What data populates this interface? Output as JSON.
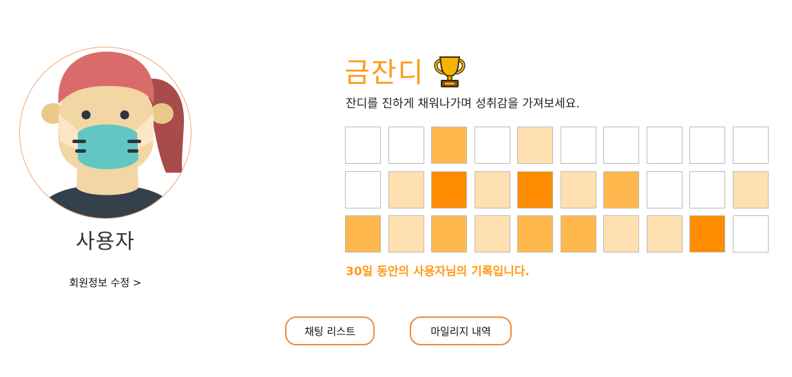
{
  "profile": {
    "name": "사용자",
    "edit_link": "회원정보 수정 >",
    "avatar_icon": "masked-user-avatar"
  },
  "grass": {
    "title": "금잔디",
    "trophy_icon": "trophy-icon",
    "subtitle": "잔디를 진하게 채워나가며 성취감을 가져보세요.",
    "record_text": "30일 동안의 사용자님의 기록입니다.",
    "levels": [
      0,
      0,
      2,
      0,
      1,
      0,
      0,
      0,
      0,
      0,
      0,
      1,
      3,
      1,
      3,
      1,
      2,
      0,
      0,
      1,
      2,
      1,
      2,
      1,
      2,
      2,
      1,
      1,
      3,
      0
    ],
    "level_colors": [
      "#ffffff",
      "#ffe0b0",
      "#ffb84d",
      "#ff8c00"
    ]
  },
  "buttons": {
    "chat_list": "채팅 리스트",
    "mileage_history": "마일리지 내역"
  }
}
